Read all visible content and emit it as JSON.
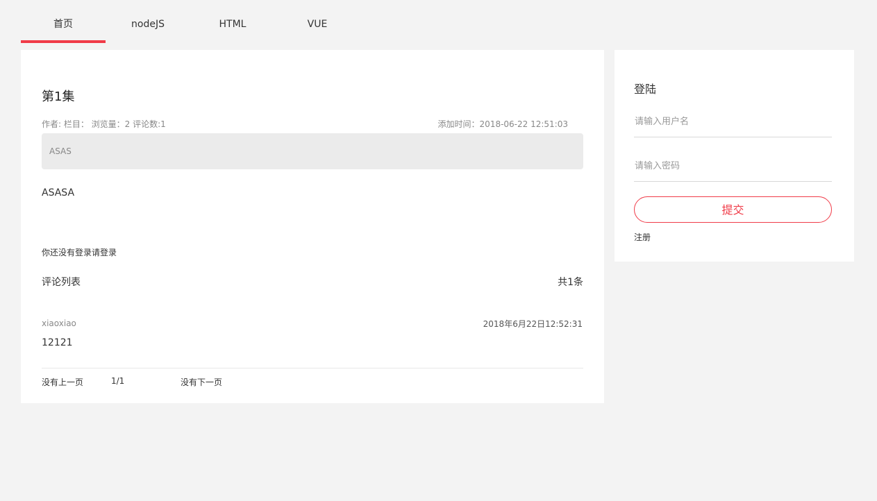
{
  "nav": {
    "tabs": [
      {
        "label": "首页",
        "active": true
      },
      {
        "label": "nodeJS"
      },
      {
        "label": "HTML"
      },
      {
        "label": "VUE"
      }
    ],
    "accent_color": "#f03b48"
  },
  "article": {
    "title": "第1集",
    "meta_left": "作者: 栏目： 浏览量：2 评论数:1",
    "meta_right": "添加时间：2018-06-22 12:51:03",
    "summary": "ASAS",
    "content": "ASASA"
  },
  "comments": {
    "login_hint": "你还没有登录请登录",
    "header": "评论列表",
    "count": "共1条",
    "items": [
      {
        "user": "xiaoxiao",
        "time": "2018年6月22日12:52:31",
        "text": "12121"
      }
    ]
  },
  "pager": {
    "prev": "没有上一页",
    "page": "1/1",
    "next": "没有下一页"
  },
  "login": {
    "title": "登陆",
    "username_placeholder": "请输入用户名",
    "password_placeholder": "请输入密码",
    "submit_label": "提交",
    "register_label": "注册"
  }
}
